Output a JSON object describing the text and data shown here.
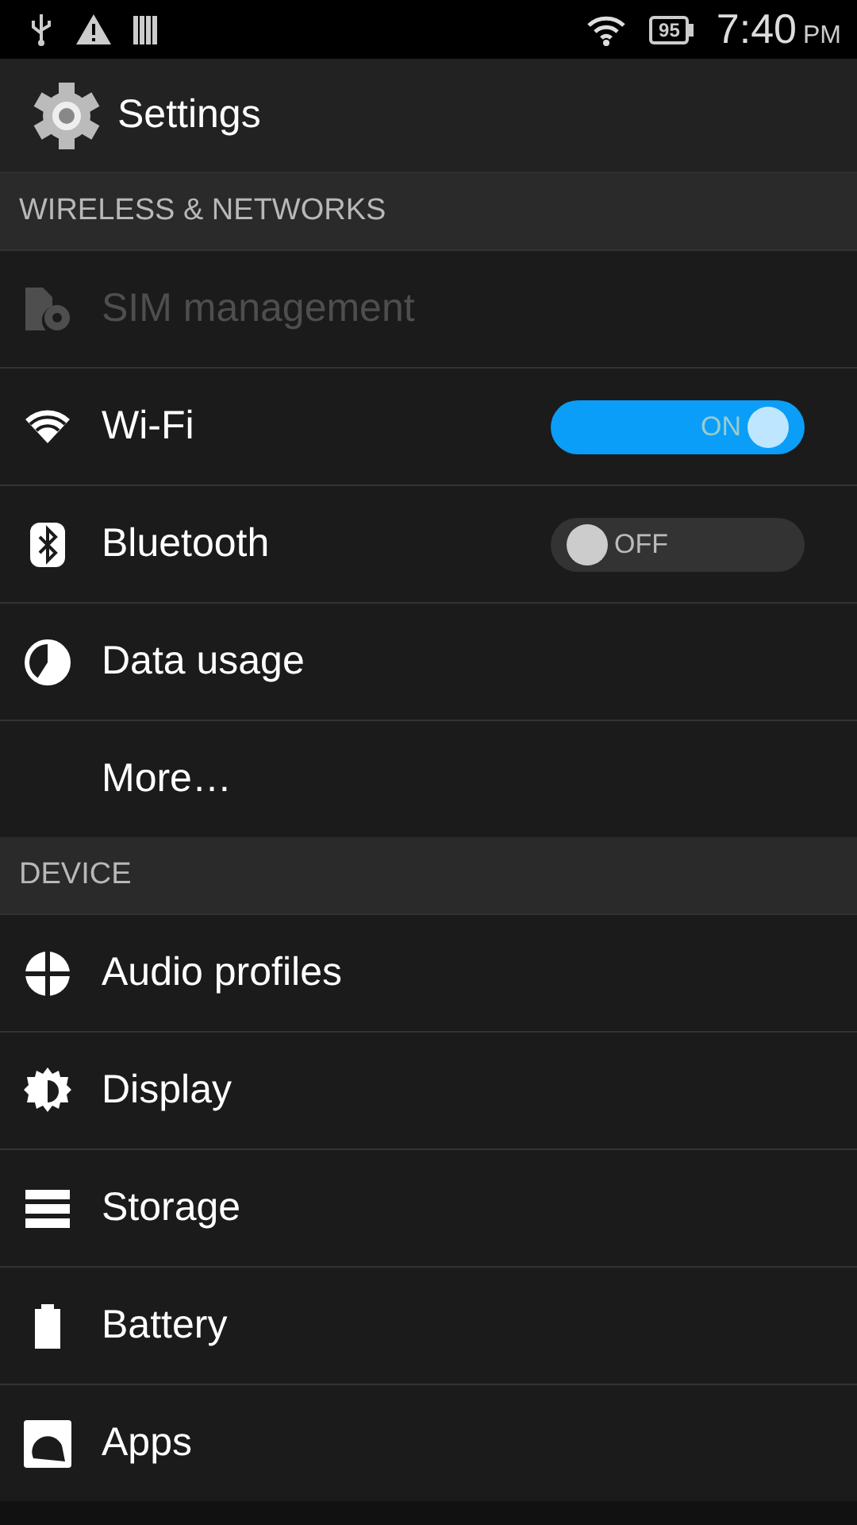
{
  "status_bar": {
    "battery": "95",
    "time": "7:40",
    "meridiem": "PM"
  },
  "header": {
    "title": "Settings"
  },
  "sections": [
    {
      "title": "WIRELESS & NETWORKS",
      "items": [
        {
          "label": "SIM management",
          "kind": "item",
          "disabled": true
        },
        {
          "label": "Wi-Fi",
          "kind": "switch",
          "disabled": false,
          "on": true,
          "switch_label": "ON"
        },
        {
          "label": "Bluetooth",
          "kind": "switch",
          "disabled": false,
          "on": false,
          "switch_label": "OFF"
        },
        {
          "label": "Data usage",
          "kind": "item",
          "disabled": false
        },
        {
          "label": "More…",
          "kind": "item",
          "disabled": false
        }
      ]
    },
    {
      "title": "DEVICE",
      "items": [
        {
          "label": "Audio profiles",
          "kind": "item",
          "disabled": false
        },
        {
          "label": "Display",
          "kind": "item",
          "disabled": false
        },
        {
          "label": "Storage",
          "kind": "item",
          "disabled": false
        },
        {
          "label": "Battery",
          "kind": "item",
          "disabled": false
        },
        {
          "label": "Apps",
          "kind": "item",
          "disabled": false
        }
      ]
    }
  ]
}
